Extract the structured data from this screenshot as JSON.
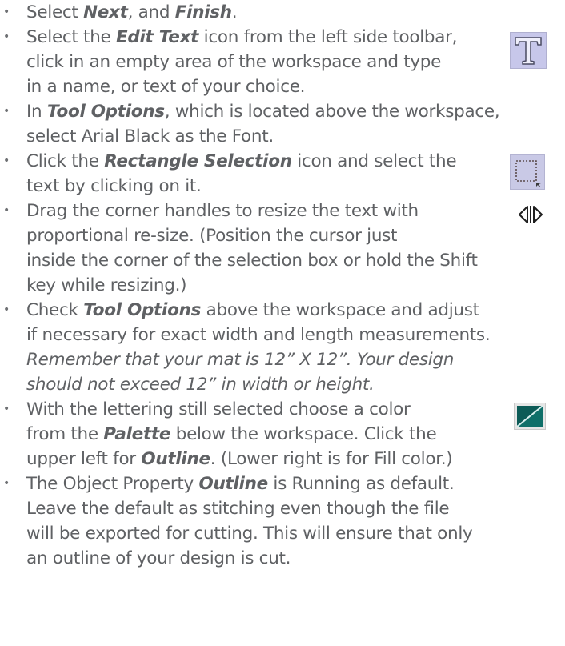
{
  "steps": [
    {
      "l1a": "Select ",
      "l1b": "Next",
      "l1c": ", and ",
      "l1d": "Finish",
      "l1e": "."
    },
    {
      "l1a": "Select the ",
      "l1b": "Edit Text",
      "l1c": " icon from the left side toolbar,",
      "l2": "click in an empty area of the workspace and type",
      "l3": "in a name, or text of your choice."
    },
    {
      "l1a": "In ",
      "l1b": "Tool Options",
      "l1c": ", which is located above the workspace,",
      "l2": "select Arial Black as the Font."
    },
    {
      "l1a": "Click the ",
      "l1b": "Rectangle Selection",
      "l1c": " icon and select the",
      "l2": "text by clicking on it."
    },
    {
      "l1": "Drag the corner handles to resize the text with",
      "l2": "proportional re-size. (Position the cursor just",
      "l3": "inside the corner of the selection box or hold the Shift",
      "l4": "key while resizing.)"
    },
    {
      "l1a": "Check ",
      "l1b": "Tool Options",
      "l1c": " above the workspace and adjust",
      "l2": "if necessary for exact width and length measurements.",
      "l3": "Remember that your mat is 12” X 12”. Your design",
      "l4": "should not exceed 12” in width or height."
    },
    {
      "l1": "With the lettering still selected choose a color",
      "l2a": "from the ",
      "l2b": "Palette",
      "l2c": " below the workspace. Click the",
      "l3a": "upper left for ",
      "l3b": "Outline",
      "l3c": ". (Lower right is for Fill color.)"
    },
    {
      "l1a": "The Object Property ",
      "l1b": "Outline",
      "l1c": " is Running as default.",
      "l2": "Leave the default as stitching even though the file",
      "l3": "will be exported for cutting. This will ensure that only",
      "l4": "an outline of your design is cut."
    }
  ],
  "bullet_glyph": "•",
  "icons": [
    "edit-text-icon",
    "rectangle-selection-icon",
    "resize-cursor-icon",
    "palette-color-icon"
  ]
}
